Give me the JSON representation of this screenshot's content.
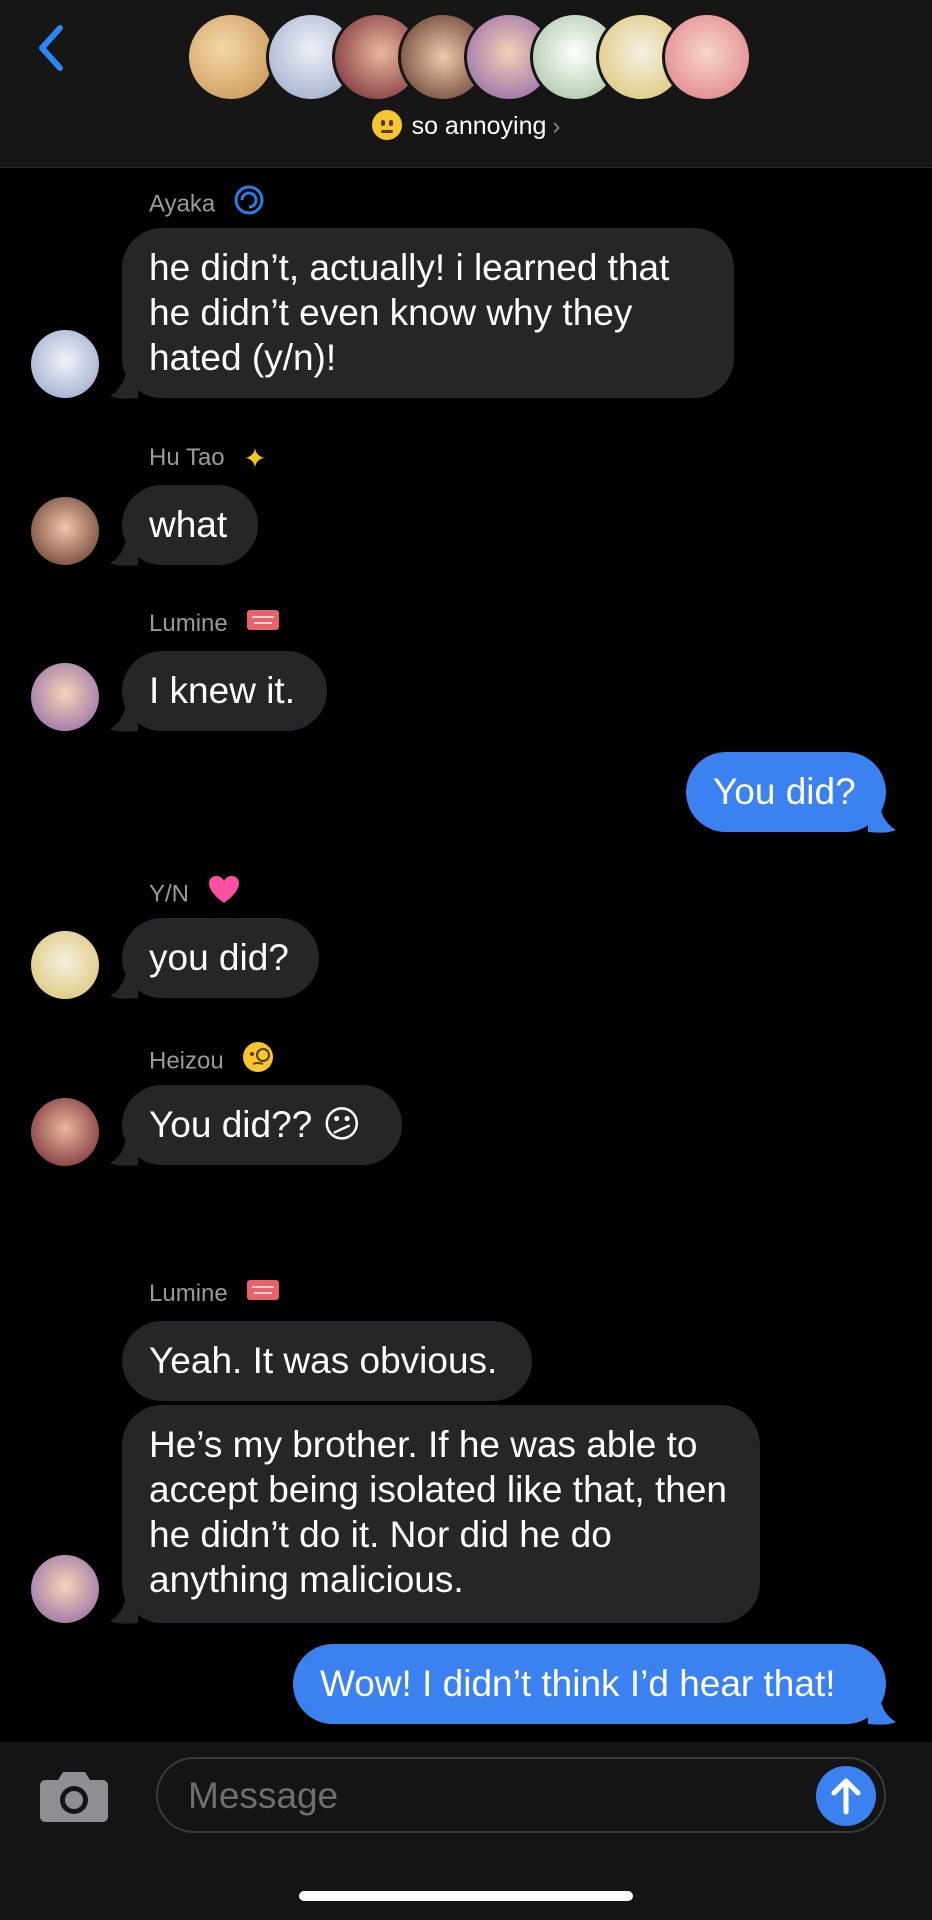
{
  "header": {
    "group_name": "so annoying",
    "group_emoji": "neutral-face",
    "back_icon": "chevron-left-icon",
    "avatar_count": 8
  },
  "messages": [
    {
      "sender": "Ayaka",
      "sender_tag": "cyclone",
      "direction": "incoming",
      "text": "he didn’t, actually! i learned that he didn’t even know why they hated (y/n)!"
    },
    {
      "sender": "Hu Tao",
      "sender_tag": "sparkles",
      "direction": "incoming",
      "text": "what"
    },
    {
      "sender": "Lumine",
      "sender_tag": "admit-one-ticket",
      "direction": "incoming",
      "text": "I knew it."
    },
    {
      "direction": "outgoing",
      "text": "You did?"
    },
    {
      "sender": "Y/N",
      "sender_tag": "pink-heart",
      "direction": "incoming",
      "text": "you did?"
    },
    {
      "sender": "Heizou",
      "sender_tag": "face-with-monocle",
      "direction": "incoming",
      "text": "You did?? 😕"
    },
    {
      "sender": "Lumine",
      "sender_tag": "admit-one-ticket",
      "direction": "incoming",
      "text": "Yeah. It was obvious."
    },
    {
      "direction": "incoming",
      "text": "He’s my brother. If he was able to accept being isolated like that, then he didn’t do it. Nor did he do anything malicious."
    },
    {
      "direction": "outgoing",
      "text": "Wow! I didn’t think I’d hear that!"
    }
  ],
  "input": {
    "placeholder": "Message",
    "camera_icon": "camera-icon",
    "send_icon": "arrow-up-icon"
  },
  "colors": {
    "outgoing_bubble": "#3b82f0",
    "incoming_bubble": "#262628",
    "background": "#000000",
    "sender_label": "#9a9a9e"
  }
}
